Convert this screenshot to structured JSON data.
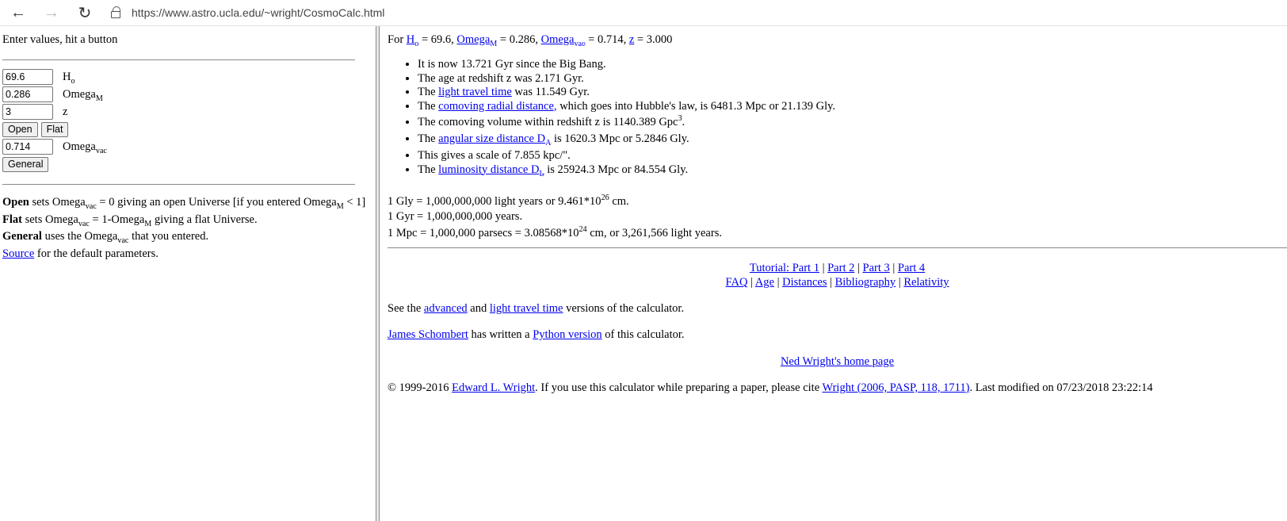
{
  "browser": {
    "url": "https://www.astro.ucla.edu/~wright/CosmoCalc.html",
    "back_glyph": "←",
    "forward_glyph": "→",
    "reload_glyph": "↻"
  },
  "left": {
    "intro": "Enter values, hit a button",
    "h0_value": "69.6",
    "h0_label": "H",
    "h0_sub": "o",
    "omegam_value": "0.286",
    "omegam_label": "Omega",
    "omegam_sub": "M",
    "z_value": "3",
    "z_label": "z",
    "open_btn": "Open",
    "flat_btn": "Flat",
    "omegavac_value": "0.714",
    "omegavac_label": "Omega",
    "omegavac_sub": "vac",
    "general_btn": "General",
    "help": {
      "open_bold": "Open",
      "open_text1": " sets Omega",
      "open_sub1": "vac",
      "open_text2": " = 0 giving an open Universe [if you entered Omega",
      "open_sub2": "M",
      "open_text3": " < 1]",
      "flat_bold": "Flat",
      "flat_text1": " sets Omega",
      "flat_sub1": "vac",
      "flat_text2": " = 1-Omega",
      "flat_sub2": "M",
      "flat_text3": " giving a flat Universe.",
      "general_bold": "General",
      "general_text1": " uses the Omega",
      "general_sub1": "vac",
      "general_text2": " that you entered.",
      "source_link": "Source",
      "source_text": " for the default parameters."
    }
  },
  "right": {
    "header": {
      "for": "For ",
      "h_link": "H",
      "h_sub": "o",
      "h_val": " = 69.6, ",
      "om_link": "Omega",
      "om_sub": "M",
      "om_val": " = 0.286, ",
      "ov_link": "Omega",
      "ov_sub": "vac",
      "ov_val": " = 0.714, ",
      "z_link": "z",
      "z_val": " = 3.000"
    },
    "results": {
      "r1": "It is now 13.721 Gyr since the Big Bang.",
      "r2": "The age at redshift z was 2.171 Gyr.",
      "r3_pre": "The ",
      "r3_link": "light travel time",
      "r3_post": " was 11.549 Gyr.",
      "r4_pre": "The ",
      "r4_link": "comoving radial distance,",
      "r4_post": " which goes into Hubble's law, is 6481.3 Mpc or 21.139 Gly.",
      "r5_pre": "The comoving volume within redshift z is 1140.389 Gpc",
      "r5_sup": "3",
      "r5_post": ".",
      "r6_pre": "The ",
      "r6_link": "angular size distance D",
      "r6_sub": "A",
      "r6_post": " is 1620.3 Mpc or 5.2846 Gly.",
      "r7": "This gives a scale of 7.855 kpc/\".",
      "r8_pre": "The ",
      "r8_link": "luminosity distance D",
      "r8_sub": "L",
      "r8_post": " is 25924.3 Mpc or 84.554 Gly."
    },
    "units": {
      "u1_pre": "1 Gly = 1,000,000,000 light years or 9.461*10",
      "u1_sup": "26",
      "u1_post": " cm.",
      "u2": "1 Gyr = 1,000,000,000 years.",
      "u3_pre": "1 Mpc = 1,000,000 parsecs = 3.08568*10",
      "u3_sup": "24",
      "u3_post": " cm, or 3,261,566 light years."
    },
    "nav": {
      "tutorial1": "Tutorial: Part 1",
      "part2": "Part 2",
      "part3": "Part 3",
      "part4": "Part 4",
      "faq": "FAQ",
      "age": "Age",
      "distances": "Distances",
      "bibliography": "Bibliography",
      "relativity": "Relativity",
      "sep": " | "
    },
    "versions": {
      "pre": "See the ",
      "advanced": "advanced",
      "and": " and ",
      "ltt": "light travel time",
      "post": " versions of the calculator."
    },
    "python": {
      "author": "James Schombert",
      "mid": " has written a ",
      "link": "Python version",
      "post": " of this calculator."
    },
    "home": "Ned Wright's home page",
    "footer": {
      "pre": "© 1999-2016 ",
      "author": "Edward L. Wright",
      "mid": ". If you use this calculator while preparing a paper, please cite ",
      "cite": "Wright (2006, PASP, 118, 1711)",
      "post": ". Last modified on 07/23/2018 23:22:14"
    }
  }
}
